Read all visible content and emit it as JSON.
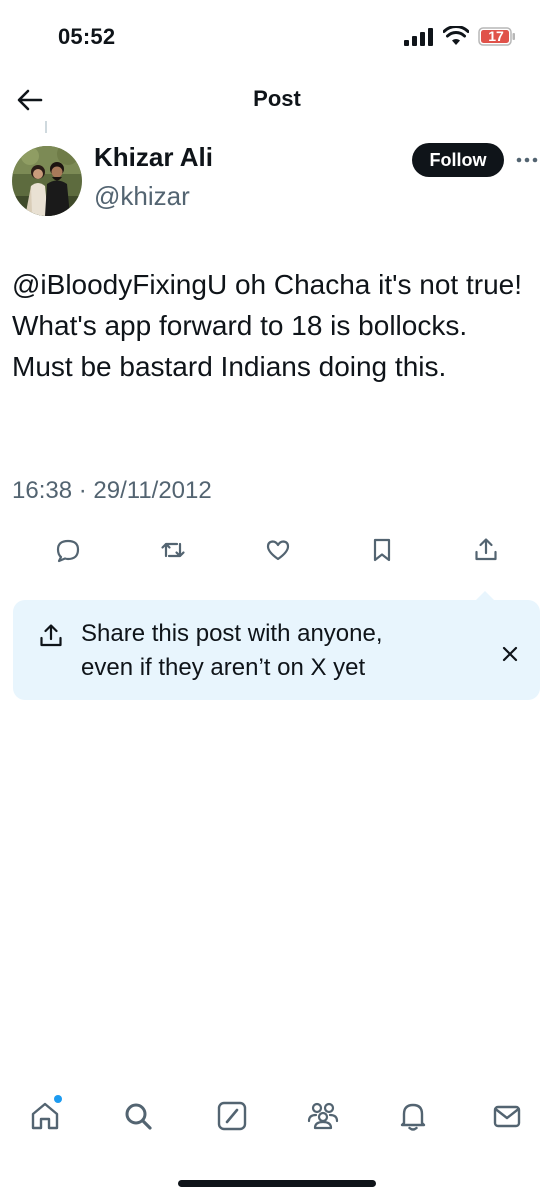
{
  "status_bar": {
    "time": "05:52",
    "battery_level": "17",
    "battery_color": "#e0524a"
  },
  "header": {
    "title": "Post",
    "back_icon": "arrow-left-icon"
  },
  "post": {
    "author": {
      "display_name": "Khizar Ali",
      "handle": "@khizar"
    },
    "follow_label": "Follow",
    "more_icon": "more-horizontal-icon",
    "text": "@iBloodyFixingU oh Chacha it's not true! What's app forward to 18 is bollocks. Must be bastard Indians doing this.",
    "timestamp": "16:38 · 29/11/2012",
    "actions": [
      {
        "name": "reply",
        "icon": "comment-icon"
      },
      {
        "name": "repost",
        "icon": "repost-icon"
      },
      {
        "name": "like",
        "icon": "heart-icon"
      },
      {
        "name": "bookmark",
        "icon": "bookmark-icon"
      },
      {
        "name": "share",
        "icon": "share-icon"
      }
    ]
  },
  "share_banner": {
    "line1": "Share this post with anyone,",
    "line2": "even if they aren’t on X yet",
    "icon": "share-icon",
    "close_icon": "close-icon",
    "background": "#e8f5fd"
  },
  "bottom_nav": {
    "items": [
      {
        "name": "home",
        "icon": "home-icon",
        "has_notification_dot": true
      },
      {
        "name": "search",
        "icon": "search-icon"
      },
      {
        "name": "grok",
        "icon": "grok-icon"
      },
      {
        "name": "communities",
        "icon": "communities-icon"
      },
      {
        "name": "notifications",
        "icon": "bell-icon"
      },
      {
        "name": "messages",
        "icon": "mail-icon"
      }
    ],
    "accent_color": "#1d9bf0"
  }
}
